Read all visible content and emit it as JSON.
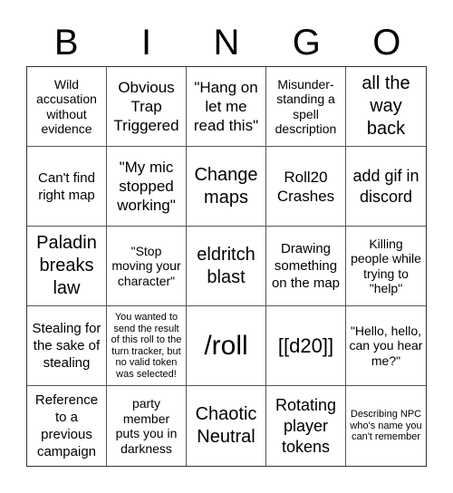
{
  "header": {
    "letters": [
      "B",
      "I",
      "N",
      "G",
      "O"
    ]
  },
  "cells": [
    "Wild accusation without evidence",
    "Obvious Trap Triggered",
    "\"Hang on let me read this\"",
    "Misunder-standing a spell description",
    "all the way back",
    "Can't find right map",
    "\"My mic stopped working\"",
    "Change maps",
    "Roll20 Crashes",
    "add gif in discord",
    "Paladin breaks law",
    "\"Stop moving your character\"",
    "eldritch blast",
    "Drawing something on the map",
    "Killing people while trying to \"help\"",
    "Stealing for the sake of stealing",
    "You wanted to send the result of this roll to the turn tracker, but no valid token was selected!",
    "/roll",
    "[[d20]]",
    "\"Hello, hello, can you hear me?\"",
    "Reference to a previous campaign",
    "party member puts you in darkness",
    "Chaotic Neutral",
    "Rotating player tokens",
    "Describing NPC who's name you can't remember"
  ]
}
